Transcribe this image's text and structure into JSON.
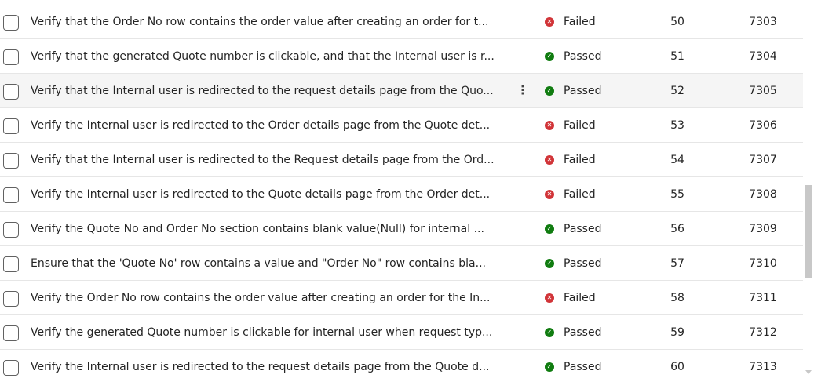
{
  "rows": [
    {
      "title": "Verify that the Order No row contains the order value after creating an order for t...",
      "status": "Failed",
      "status_icon": "x-circle-icon",
      "col1": "50",
      "col2": "7303"
    },
    {
      "title": "Verify that the generated Quote number is clickable, and that the Internal user is r...",
      "status": "Passed",
      "status_icon": "check-circle-icon",
      "col1": "51",
      "col2": "7304"
    },
    {
      "title": "Verify that the Internal user is redirected to the request details page from the Quo...",
      "status": "Passed",
      "status_icon": "check-circle-icon",
      "col1": "52",
      "col2": "7305",
      "more_glyph": "⋮"
    },
    {
      "title": "Verify the Internal user is redirected to the Order details page from the Quote det...",
      "status": "Failed",
      "status_icon": "x-circle-icon",
      "col1": "53",
      "col2": "7306"
    },
    {
      "title": "Verify that the Internal user is redirected to the Request details page from the Ord...",
      "status": "Failed",
      "status_icon": "x-circle-icon",
      "col1": "54",
      "col2": "7307"
    },
    {
      "title": "Verify the Internal user is redirected to the Quote details page from the Order det...",
      "status": "Failed",
      "status_icon": "x-circle-icon",
      "col1": "55",
      "col2": "7308"
    },
    {
      "title": "Verify the Quote No and Order No section contains blank value(Null) for internal ...",
      "status": "Passed",
      "status_icon": "check-circle-icon",
      "col1": "56",
      "col2": "7309"
    },
    {
      "title": "Ensure that the 'Quote No' row contains a value and \"Order No\" row contains bla...",
      "status": "Passed",
      "status_icon": "check-circle-icon",
      "col1": "57",
      "col2": "7310"
    },
    {
      "title": "Verify the Order No row contains the order value after creating an order for the In...",
      "status": "Failed",
      "status_icon": "x-circle-icon",
      "col1": "58",
      "col2": "7311"
    },
    {
      "title": "Verify the generated Quote number is clickable for internal user when request typ...",
      "status": "Passed",
      "status_icon": "check-circle-icon",
      "col1": "59",
      "col2": "7312"
    },
    {
      "title": "Verify the Internal user is redirected to the request details page from the Quote d...",
      "status": "Passed",
      "status_icon": "check-circle-icon",
      "col1": "60",
      "col2": "7313"
    }
  ],
  "colors": {
    "failed": "#d13438",
    "passed": "#107c10",
    "hover_row": "#f5f5f5"
  }
}
